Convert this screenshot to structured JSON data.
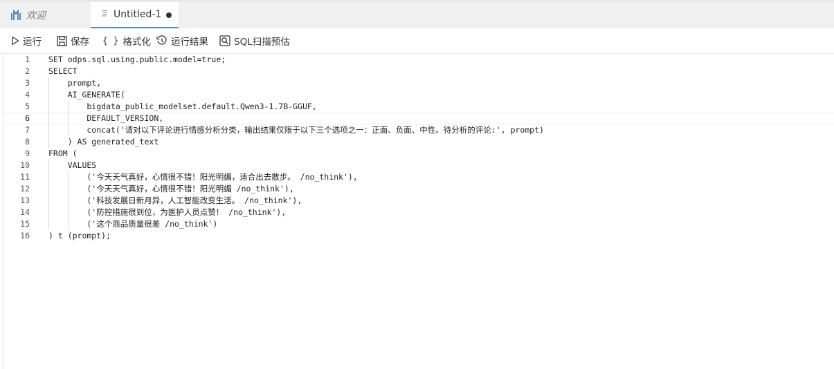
{
  "tabs": {
    "welcome_label": "欢迎",
    "untitled_label": "Untitled-1"
  },
  "toolbar": {
    "run_label": "运行",
    "save_label": "保存",
    "format_braces": "{ }",
    "format_label": "格式化",
    "results_label": "运行结果",
    "scan_label": "SQL扫描预估"
  },
  "editor": {
    "current_line": 6,
    "lines": [
      {
        "n": "1",
        "text": "SET odps.sql.using.public.model=true;"
      },
      {
        "n": "2",
        "text": "SELECT"
      },
      {
        "n": "3",
        "text": "    prompt,"
      },
      {
        "n": "4",
        "text": "    AI_GENERATE("
      },
      {
        "n": "5",
        "text": "        bigdata_public_modelset.default.Qwen3-1.7B-GGUF,"
      },
      {
        "n": "6",
        "text": "        DEFAULT_VERSION,"
      },
      {
        "n": "7",
        "text": "        concat('请对以下评论进行情感分析分类，输出结果仅限于以下三个选项之一：正面、负面、中性。待分析的评论:', prompt)"
      },
      {
        "n": "8",
        "text": "    ) AS generated_text"
      },
      {
        "n": "9",
        "text": "FROM ("
      },
      {
        "n": "10",
        "text": "    VALUES"
      },
      {
        "n": "11",
        "text": "        ('今天天气真好，心情很不错！阳光明媚，适合出去散步。 /no_think'),"
      },
      {
        "n": "12",
        "text": "        ('今天天气真好，心情很不错！阳光明媚 /no_think'),"
      },
      {
        "n": "13",
        "text": "        ('科技发展日新月异，人工智能改变生活。 /no_think'),"
      },
      {
        "n": "14",
        "text": "        ('防控措施很到位，为医护人员点赞！ /no_think'),"
      },
      {
        "n": "15",
        "text": "        ('这个商品质量很差 /no_think')"
      },
      {
        "n": "16",
        "text": ") t (prompt);"
      }
    ]
  },
  "colors": {
    "tabbar_bg": "#f0f0f0",
    "active_tab_border": "#4a90d9",
    "logo": "#2f6fbf"
  }
}
